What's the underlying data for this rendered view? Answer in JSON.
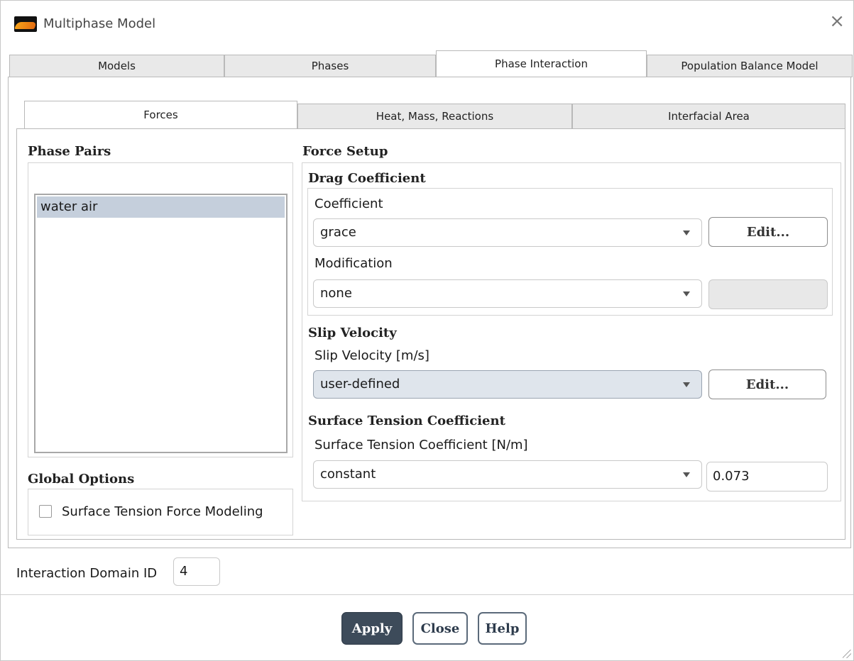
{
  "window": {
    "title": "Multiphase Model",
    "close_symbol": "×",
    "icon": "fluent-app-icon"
  },
  "main_tabs": [
    {
      "label": "Models",
      "active": false
    },
    {
      "label": "Phases",
      "active": false
    },
    {
      "label": "Phase Interaction",
      "active": true
    },
    {
      "label": "Population Balance Model",
      "active": false
    }
  ],
  "sub_tabs": [
    {
      "label": "Forces",
      "active": true
    },
    {
      "label": "Heat, Mass, Reactions",
      "active": false
    },
    {
      "label": "Interfacial Area",
      "active": false
    }
  ],
  "phase_pairs": {
    "heading": "Phase Pairs",
    "items": [
      "water air"
    ],
    "selected": "water air"
  },
  "global_options": {
    "heading": "Global Options",
    "surface_tension_force_modeling": {
      "label": "Surface Tension Force Modeling",
      "checked": false
    }
  },
  "force_setup": {
    "heading": "Force Setup",
    "drag": {
      "heading": "Drag Coefficient",
      "coefficient_label": "Coefficient",
      "coefficient_value": "grace",
      "coefficient_edit_label": "Edit...",
      "modification_label": "Modification",
      "modification_value": "none"
    },
    "slip": {
      "heading": "Slip Velocity",
      "label": "Slip Velocity [m/s]",
      "value": "user-defined",
      "edit_label": "Edit..."
    },
    "surface_tension": {
      "heading": "Surface Tension Coefficient",
      "label": "Surface Tension Coefficient [N/m]",
      "method": "constant",
      "value": "0.073"
    }
  },
  "interaction_domain": {
    "label": "Interaction Domain ID",
    "value": "4"
  },
  "buttons": {
    "apply": "Apply",
    "close": "Close",
    "help": "Help"
  },
  "colors": {
    "selection": "#c5cfdc",
    "primary_button": "#3d4b5a",
    "accent": "#f7a21a"
  }
}
